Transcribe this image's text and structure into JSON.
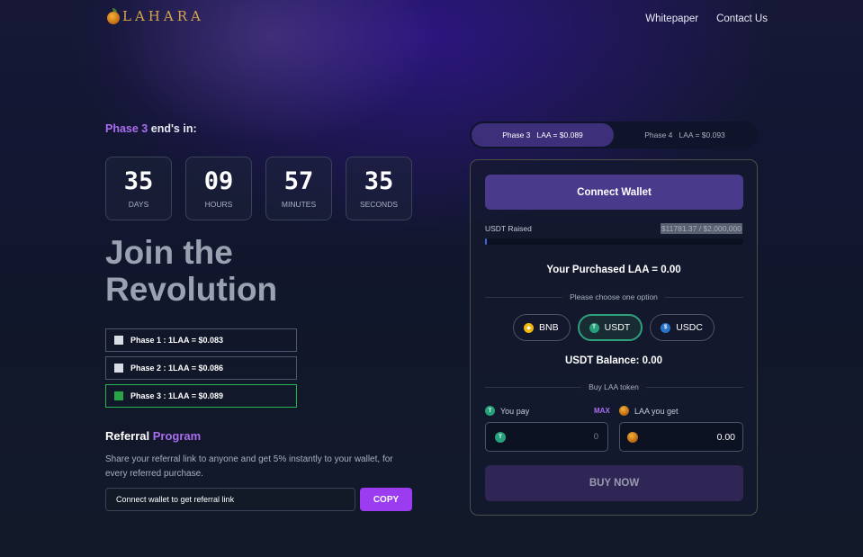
{
  "header": {
    "logo_text": "LAHARA",
    "nav": [
      "Whitepaper",
      "Contact Us"
    ]
  },
  "left": {
    "phase_prefix": "Phase 3",
    "phase_suffix": " end's in:",
    "countdown": [
      {
        "value": "35",
        "label": "DAYS"
      },
      {
        "value": "09",
        "label": "HOURS"
      },
      {
        "value": "57",
        "label": "MINUTES"
      },
      {
        "value": "35",
        "label": "SECONDS"
      }
    ],
    "hero_line1": "Join the",
    "hero_line2": "Revolution",
    "phases": [
      {
        "label": "Phase 1 : 1LAA = $0.083",
        "active": false
      },
      {
        "label": "Phase 2 : 1LAA = $0.086",
        "active": false
      },
      {
        "label": "Phase 3 : 1LAA = $0.089",
        "active": true
      }
    ],
    "referral_title_1": "Referral",
    "referral_title_2": " Program",
    "referral_desc": "Share your referral link to anyone and get 5% instantly to your wallet, for every referred purchase.",
    "referral_input": "Connect wallet to get referral link",
    "copy_label": "COPY"
  },
  "right": {
    "tabs": [
      {
        "label": "Phase 3   LAA = $0.089",
        "active": true
      },
      {
        "label": "Phase 4   LAA = $0.093",
        "active": false
      }
    ],
    "connect_label": "Connect Wallet",
    "raised_label": "USDT Raised",
    "raised_value": "$11781.37 / $2,000,000",
    "raised_fraction": 0.0059,
    "purchased": "Your Purchased LAA = 0.00",
    "choose_option": "Please choose one option",
    "tokens": [
      {
        "symbol": "BNB",
        "icon": "bnb-icon"
      },
      {
        "symbol": "USDT",
        "icon": "usdt-icon",
        "active": true
      },
      {
        "symbol": "USDC",
        "icon": "usdc-icon"
      }
    ],
    "balance": "USDT Balance: 0.00",
    "buy_section": "Buy LAA token",
    "you_pay": "You pay",
    "max": "MAX",
    "you_get": "LAA you get",
    "pay_value": "0",
    "get_value": "0.00",
    "buy_label": "BUY NOW"
  },
  "colors": {
    "accent": "#a96ef0",
    "active_phase": "#27a447",
    "usdt": "#26a17b",
    "bnb": "#f0b90b",
    "usdc": "#2775ca"
  }
}
